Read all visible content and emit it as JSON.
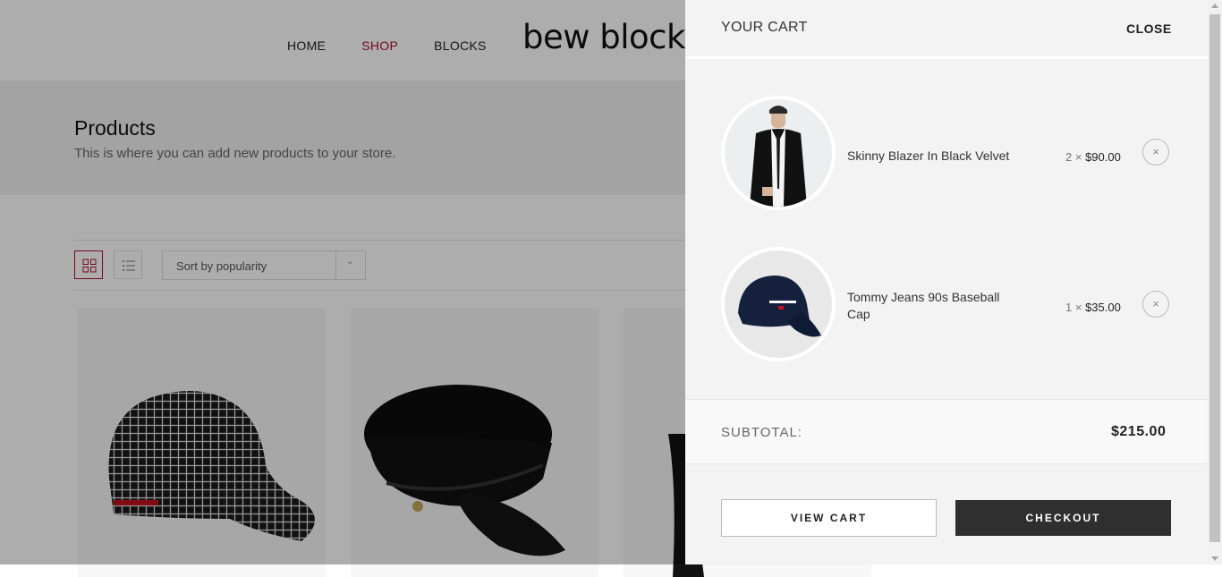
{
  "site": {
    "logo": "bew blocks",
    "nav": [
      {
        "label": "HOME",
        "active": false
      },
      {
        "label": "SHOP",
        "active": true
      },
      {
        "label": "BLOCKS",
        "active": false
      }
    ]
  },
  "banner": {
    "title": "Products",
    "subtitle": "This is where you can add new products to your store."
  },
  "toolbar": {
    "sort_selected": "Sort by popularity",
    "views": [
      "grid",
      "list"
    ]
  },
  "cart": {
    "title": "YOUR CART",
    "close_label": "CLOSE",
    "items": [
      {
        "name": "Skinny Blazer In Black Velvet",
        "quantity": "2",
        "times": "×",
        "price": "$90.00"
      },
      {
        "name": "Tommy Jeans 90s Baseball Cap",
        "quantity": "1",
        "times": "×",
        "price": "$35.00"
      }
    ],
    "remove_glyph": "×",
    "subtotal_label": "SUBTOTAL:",
    "subtotal_value": "$215.00",
    "view_cart_label": "VIEW CART",
    "checkout_label": "CHECKOUT"
  },
  "colors": {
    "accent": "#b0102a",
    "checkout_bg": "#2f2f2f"
  }
}
